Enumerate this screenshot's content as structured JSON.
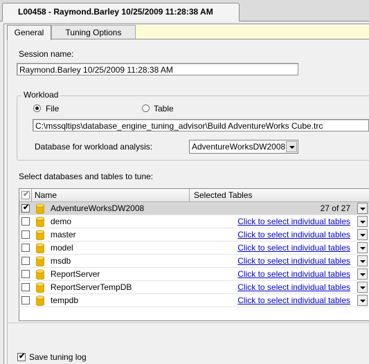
{
  "document_tab": {
    "title": "L00458 - Raymond.Barley 10/25/2009 11:28:38 AM"
  },
  "tabs": [
    {
      "label": "General",
      "active": true
    },
    {
      "label": "Tuning Options",
      "active": false
    }
  ],
  "session": {
    "label": "Session name:",
    "value": "Raymond.Barley 10/25/2009 11:28:38 AM"
  },
  "workload": {
    "group_title": "Workload",
    "options": [
      {
        "label": "File",
        "selected": true
      },
      {
        "label": "Table",
        "selected": false
      }
    ],
    "file_path": "C:\\mssqltips\\database_engine_tuning_advisor\\Build AdventureWorks Cube.trc",
    "database_label": "Database for workload analysis:",
    "database_value": "AdventureWorksDW2008"
  },
  "databases": {
    "label": "Select databases and tables to tune:",
    "columns": {
      "name": "Name",
      "tables": "Selected Tables"
    },
    "rows": [
      {
        "name": "AdventureWorksDW2008",
        "checked": true,
        "tables": "27 of 27",
        "is_link": false,
        "selected": true
      },
      {
        "name": "demo",
        "checked": false,
        "tables": "Click to select individual tables",
        "is_link": true,
        "selected": false
      },
      {
        "name": "master",
        "checked": false,
        "tables": "Click to select individual tables",
        "is_link": true,
        "selected": false
      },
      {
        "name": "model",
        "checked": false,
        "tables": "Click to select individual tables",
        "is_link": true,
        "selected": false
      },
      {
        "name": "msdb",
        "checked": false,
        "tables": "Click to select individual tables",
        "is_link": true,
        "selected": false
      },
      {
        "name": "ReportServer",
        "checked": false,
        "tables": "Click to select individual tables",
        "is_link": true,
        "selected": false
      },
      {
        "name": "ReportServerTempDB",
        "checked": false,
        "tables": "Click to select individual tables",
        "is_link": true,
        "selected": false
      },
      {
        "name": "tempdb",
        "checked": false,
        "tables": "Click to select individual tables",
        "is_link": true,
        "selected": false
      }
    ]
  },
  "footer": {
    "save_log_label": "Save tuning log",
    "save_log_checked": true
  },
  "icons": {
    "database": "database-cylinder-icon",
    "dropdown": "chevron-down-icon",
    "checkbox": "checkmark-icon"
  },
  "colors": {
    "link": "#0000cc",
    "database_icon": "#e8b400",
    "tab_strip_highlight": "#fffbd7",
    "selected_row": "#d6d6d6"
  }
}
